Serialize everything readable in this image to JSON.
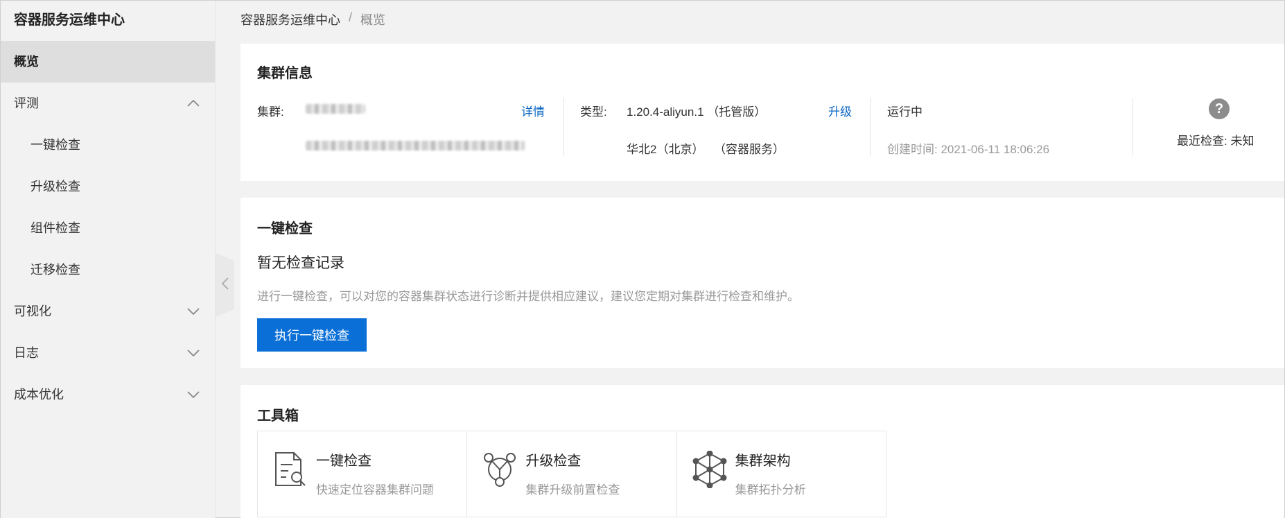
{
  "sidebar": {
    "title": "容器服务运维中心",
    "items": [
      {
        "label": "概览"
      },
      {
        "label": "评测"
      },
      {
        "label": "一键检查"
      },
      {
        "label": "升级检查"
      },
      {
        "label": "组件检查"
      },
      {
        "label": "迁移检查"
      },
      {
        "label": "可视化"
      },
      {
        "label": "日志"
      },
      {
        "label": "成本优化"
      }
    ]
  },
  "breadcrumb": {
    "root": "容器服务运维中心",
    "separator": "/",
    "current": "概览"
  },
  "cluster_info": {
    "title": "集群信息",
    "cluster_label": "集群:",
    "detail_link": "详情",
    "type_label": "类型:",
    "version": "1.20.4-aliyun.1 （托管版）",
    "upgrade_link": "升级",
    "region": "华北2（北京）",
    "service": "（容器服务）",
    "status": "运行中",
    "created_time": "创建时间: 2021-06-11 18:06:26",
    "last_check": "最近检查: 未知",
    "help_icon": "?"
  },
  "one_click_check": {
    "title": "一键检查",
    "empty_title": "暂无检查记录",
    "description": "进行一键检查，可以对您的容器集群状态进行诊断并提供相应建议，建议您定期对集群进行检查和维护。",
    "button_label": "执行一键检查"
  },
  "toolbox": {
    "title": "工具箱",
    "tools": [
      {
        "name": "一键检查",
        "desc": "快速定位容器集群问题",
        "icon": "document-search-icon"
      },
      {
        "name": "升级检查",
        "desc": "集群升级前置检查",
        "icon": "network-triangle-icon"
      },
      {
        "name": "集群架构",
        "desc": "集群拓扑分析",
        "icon": "topology-cube-icon"
      }
    ]
  },
  "colors": {
    "accent": "#0a6fd6",
    "link": "#0b66c2",
    "active_nav": "#dedede"
  }
}
